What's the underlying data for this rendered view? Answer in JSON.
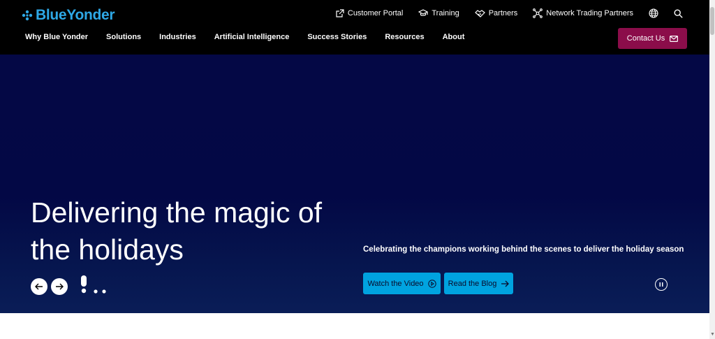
{
  "brand": {
    "name": "BlueYonder",
    "accent": "#2ea8e6"
  },
  "utility": {
    "customer_portal": "Customer Portal",
    "training": "Training",
    "partners": "Partners",
    "network_trading_partners": "Network Trading Partners"
  },
  "nav": {
    "items": [
      "Why Blue Yonder",
      "Solutions",
      "Industries",
      "Artificial Intelligence",
      "Success Stories",
      "Resources",
      "About"
    ]
  },
  "contact": {
    "label": "Contact Us",
    "color": "#8b0d4a"
  },
  "hero": {
    "title": "Delivering the magic of the holidays",
    "subtitle": "Celebrating the champions working behind the scenes to deliver the holiday season",
    "watch_label": "Watch the Video",
    "blog_label": "Read the Blog",
    "cta_color": "#00a3e0",
    "bg_color": "#040845"
  }
}
